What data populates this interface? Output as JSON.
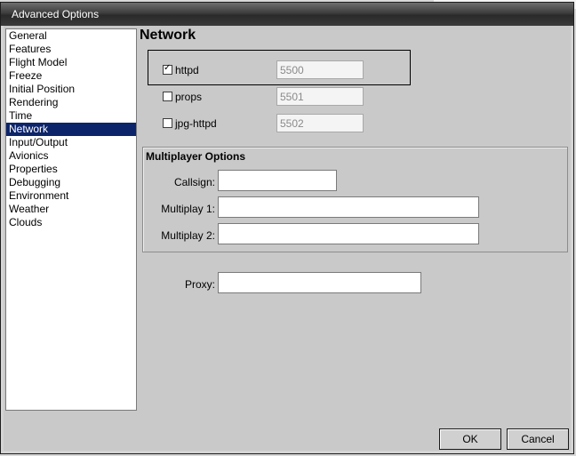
{
  "window": {
    "title": "Advanced Options"
  },
  "sidebar": {
    "items": [
      {
        "label": "General"
      },
      {
        "label": "Features"
      },
      {
        "label": "Flight Model"
      },
      {
        "label": "Freeze"
      },
      {
        "label": "Initial Position"
      },
      {
        "label": "Rendering"
      },
      {
        "label": "Time"
      },
      {
        "label": "Network",
        "selected": true
      },
      {
        "label": "Input/Output"
      },
      {
        "label": "Avionics"
      },
      {
        "label": "Properties"
      },
      {
        "label": "Debugging"
      },
      {
        "label": "Environment"
      },
      {
        "label": "Weather"
      },
      {
        "label": "Clouds"
      }
    ]
  },
  "network": {
    "title": "Network",
    "servers": [
      {
        "label": "httpd",
        "checked": true,
        "port": "5500"
      },
      {
        "label": "props",
        "checked": false,
        "port": "5501"
      },
      {
        "label": "jpg-httpd",
        "checked": false,
        "port": "5502"
      }
    ]
  },
  "multiplayer": {
    "title": "Multiplayer Options",
    "callsign_label": "Callsign:",
    "callsign_value": "",
    "multiplay1_label": "Multiplay 1:",
    "multiplay1_value": "",
    "multiplay2_label": "Multiplay 2:",
    "multiplay2_value": ""
  },
  "proxy": {
    "label": "Proxy:",
    "value": ""
  },
  "buttons": {
    "ok": "OK",
    "cancel": "Cancel"
  },
  "icons": {
    "checkbox_checked": "check-icon"
  }
}
